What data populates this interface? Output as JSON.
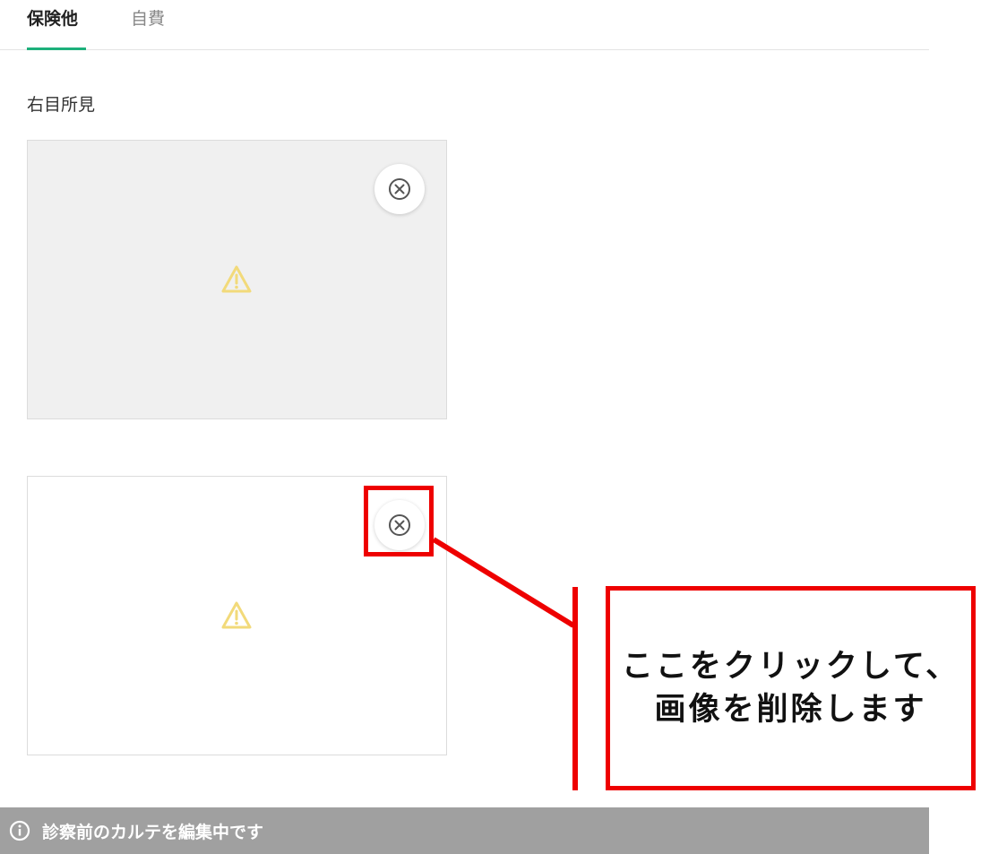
{
  "tabs": [
    {
      "label": "保険他"
    },
    {
      "label": "自費"
    }
  ],
  "section": {
    "label": "右目所見"
  },
  "cards": [
    {
      "remove_icon": "close-circle-icon",
      "placeholder_icon": "warning-triangle-icon"
    },
    {
      "remove_icon": "close-circle-icon",
      "placeholder_icon": "warning-triangle-icon"
    }
  ],
  "annotation": {
    "line1": "ここをクリックして、",
    "line2": "画像を削除します",
    "color": "#ee0000"
  },
  "status_bar": {
    "icon": "info-icon",
    "text": "診察前のカルテを編集中です"
  },
  "colors": {
    "accent": "#1db07b",
    "warning": "#f2da7a",
    "status_bg": "#a0a0a0"
  }
}
